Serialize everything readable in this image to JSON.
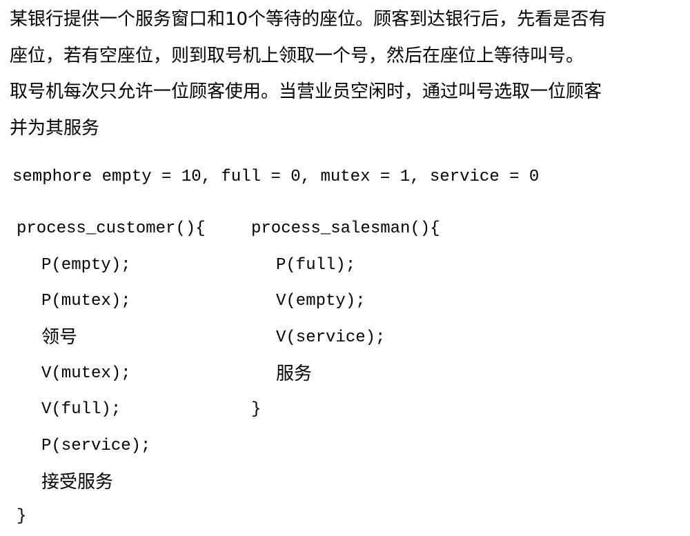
{
  "problem": {
    "lines": [
      "某银行提供一个服务窗口和10个等待的座位。顾客到达银行后，先看是否有",
      "座位，若有空座位，则到取号机上领取一个号，然后在座位上等待叫号。",
      "取号机每次只允许一位顾客使用。当营业员空闲时，通过叫号选取一位顾客",
      "并为其服务"
    ]
  },
  "semaphores": "semphore empty = 10, full = 0, mutex = 1, service = 0",
  "customer": {
    "header": "process_customer(){",
    "body": [
      "P(empty);",
      "P(mutex);",
      "领号",
      "V(mutex);",
      "V(full);",
      "P(service);",
      "接受服务"
    ],
    "close": "}"
  },
  "salesman": {
    "header": "process_salesman(){",
    "body": [
      "P(full);",
      "V(empty);",
      "V(service);",
      "服务"
    ],
    "close": "}"
  }
}
